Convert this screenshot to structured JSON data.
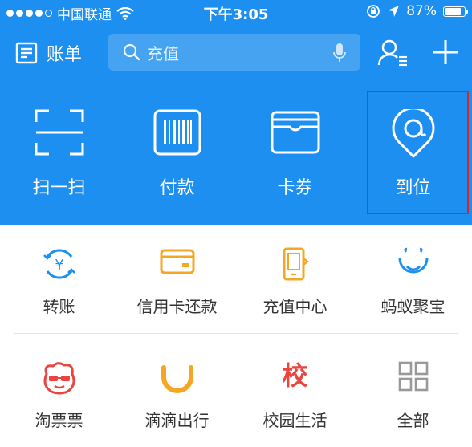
{
  "status_bar": {
    "carrier": "中国联通",
    "time": "下午3:05",
    "battery": "87%",
    "battery_level": 0.87
  },
  "nav": {
    "bill_label": "账单",
    "search_placeholder": "充值"
  },
  "actions": [
    {
      "label": "扫一扫",
      "icon": "scan-icon"
    },
    {
      "label": "付款",
      "icon": "barcode-icon"
    },
    {
      "label": "卡券",
      "icon": "card-wallet-icon"
    },
    {
      "label": "到位",
      "icon": "location-pin-icon"
    }
  ],
  "grid": [
    {
      "label": "转账",
      "icon": "transfer-icon",
      "color": "#1d8ff0"
    },
    {
      "label": "信用卡还款",
      "icon": "credit-card-icon",
      "color": "#f5a623"
    },
    {
      "label": "充值中心",
      "icon": "phone-recharge-icon",
      "color": "#f5a623"
    },
    {
      "label": "蚂蚁聚宝",
      "icon": "ant-fortune-icon",
      "color": "#1d8ff0"
    },
    {
      "label": "淘票票",
      "icon": "taopiaopiao-icon",
      "color": "#e8463f"
    },
    {
      "label": "滴滴出行",
      "icon": "didi-icon",
      "color": "#f5a623"
    },
    {
      "label": "校园生活",
      "icon": "campus-icon",
      "glyph": "校",
      "color": "#e8463f"
    },
    {
      "label": "全部",
      "icon": "all-apps-icon",
      "color": "#999999"
    }
  ],
  "colors": {
    "header_blue": "#1d8ff0",
    "highlight_red": "#d9262c"
  }
}
